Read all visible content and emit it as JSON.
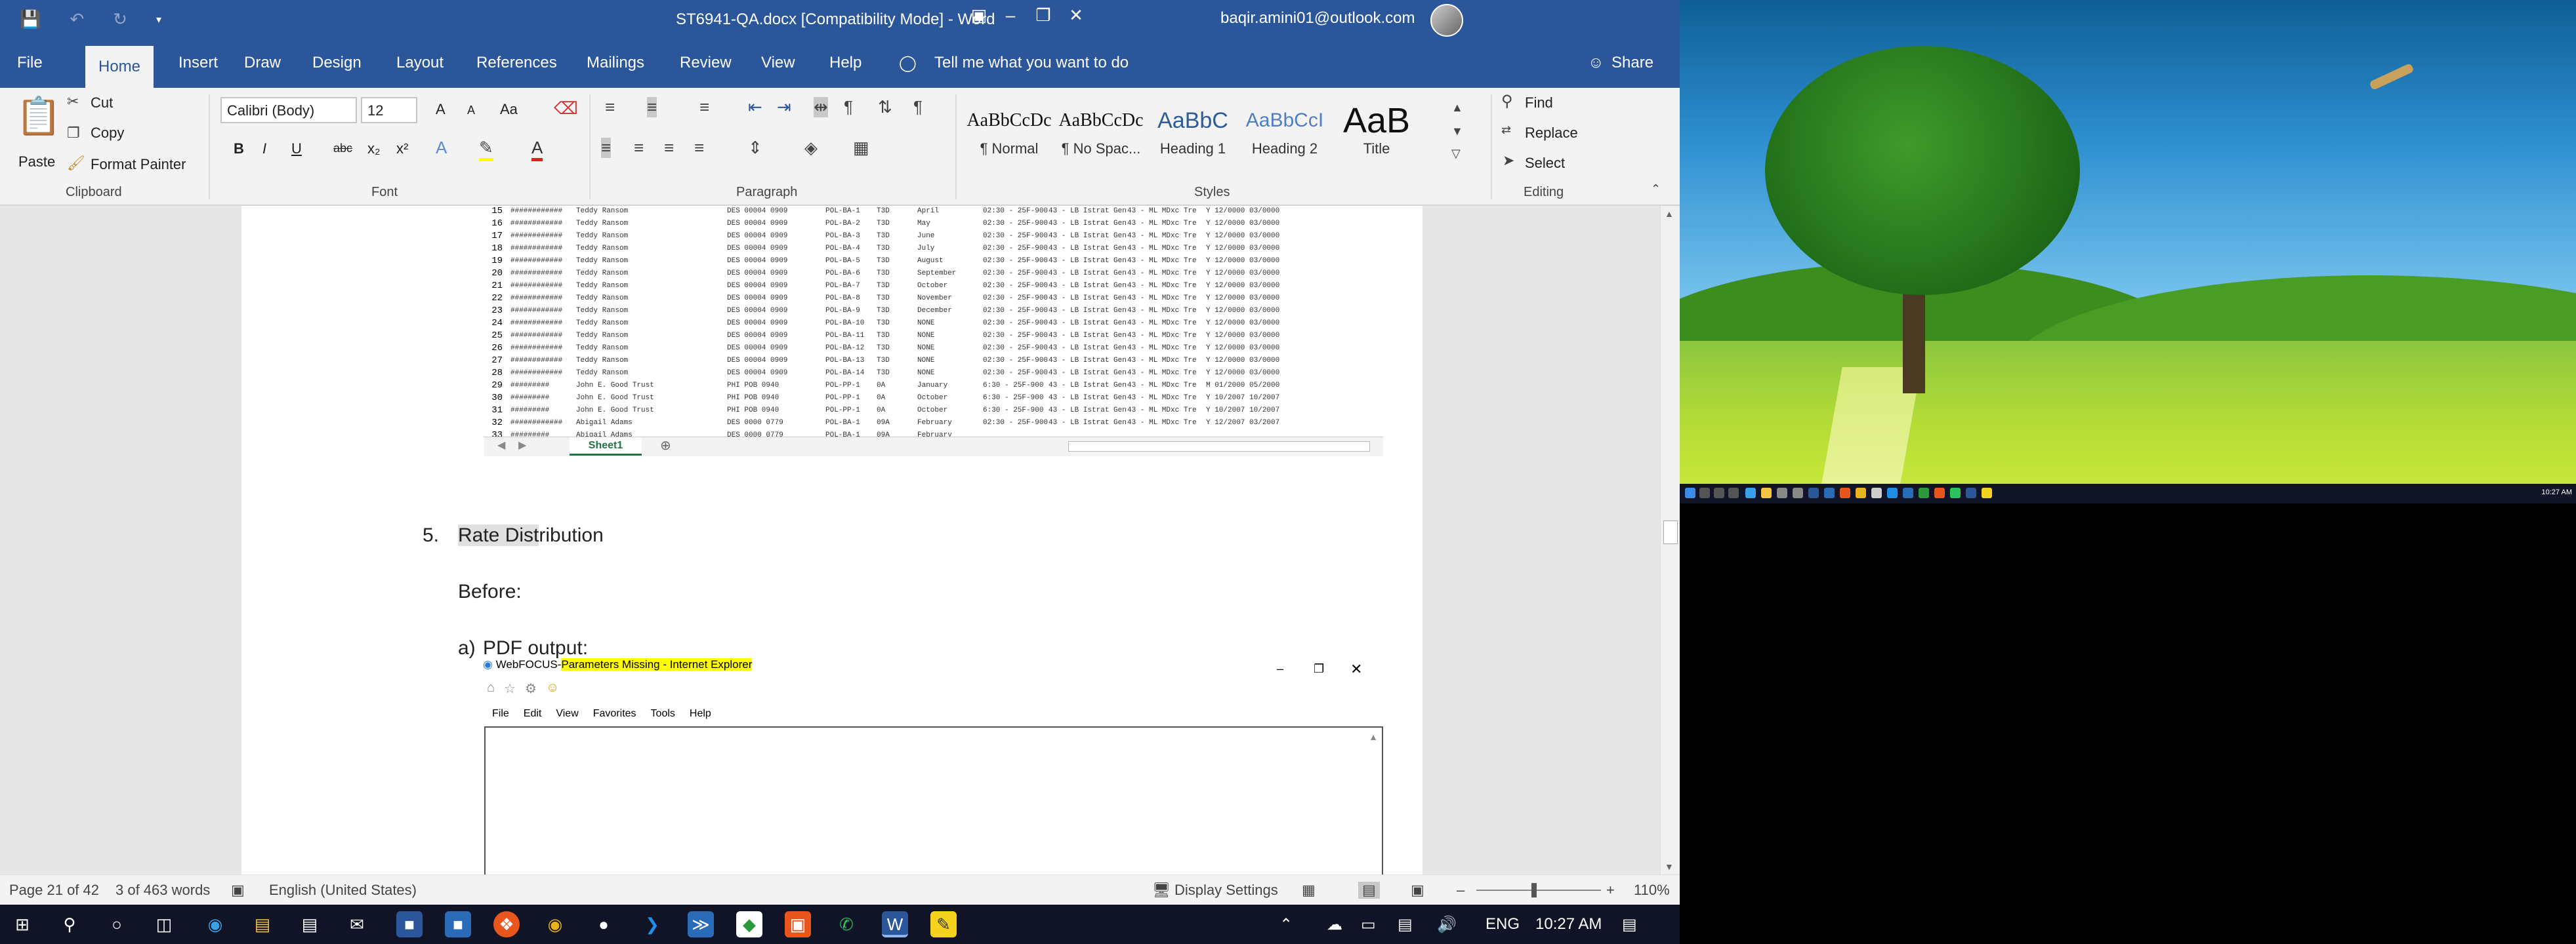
{
  "title_bar": {
    "document_title": "ST6941-QA.docx  [Compatibility Mode]  -  Word",
    "account": "baqir.amini01@outlook.com",
    "qat_icons": [
      "save-icon",
      "undo-icon",
      "redo-icon",
      "customize-qat-icon"
    ]
  },
  "tabs": {
    "file": "File",
    "home": "Home",
    "insert": "Insert",
    "draw": "Draw",
    "design": "Design",
    "layout": "Layout",
    "references": "References",
    "mailings": "Mailings",
    "review": "Review",
    "view": "View",
    "help": "Help",
    "tell_me": "Tell me what you want to do",
    "share": "Share"
  },
  "ribbon": {
    "clipboard": {
      "paste": "Paste",
      "cut": "Cut",
      "copy": "Copy",
      "format_painter": "Format Painter",
      "label": "Clipboard"
    },
    "font": {
      "name": "Calibri (Body)",
      "size": "12",
      "label": "Font",
      "bold": "B",
      "italic": "I",
      "underline": "U",
      "strike": "abc",
      "sub": "x₂",
      "sup": "x²",
      "grow": "A",
      "shrink": "A",
      "case": "Aa"
    },
    "paragraph": {
      "label": "Paragraph"
    },
    "styles": {
      "label": "Styles",
      "items": [
        {
          "preview": "AaBbCcDc",
          "name": "¶ Normal"
        },
        {
          "preview": "AaBbCcDc",
          "name": "¶ No Spac..."
        },
        {
          "preview": "AaBbC",
          "name": "Heading 1"
        },
        {
          "preview": "AaBbCcI",
          "name": "Heading 2"
        },
        {
          "preview": "AaB",
          "name": "Title"
        }
      ]
    },
    "editing": {
      "find": "Find",
      "replace": "Replace",
      "select": "Select",
      "label": "Editing"
    }
  },
  "spreadsheet": {
    "rows": [
      {
        "n": "15",
        "month": "April"
      },
      {
        "n": "16",
        "month": "May"
      },
      {
        "n": "17",
        "month": "June"
      },
      {
        "n": "18",
        "month": "July"
      },
      {
        "n": "19",
        "month": "August"
      },
      {
        "n": "20",
        "month": "September"
      },
      {
        "n": "21",
        "month": "October"
      },
      {
        "n": "22",
        "month": "November"
      },
      {
        "n": "23",
        "month": "December"
      },
      {
        "n": "24",
        "month": "NONE"
      },
      {
        "n": "25",
        "month": "NONE"
      },
      {
        "n": "26",
        "month": "NONE"
      },
      {
        "n": "27",
        "month": "NONE"
      },
      {
        "n": "28",
        "month": "NONE"
      },
      {
        "n": "29",
        "month": "January"
      },
      {
        "n": "30",
        "month": "October"
      },
      {
        "n": "31",
        "month": "October"
      },
      {
        "n": "32",
        "month": "February"
      },
      {
        "n": "33",
        "month": "February"
      }
    ],
    "sheet_tab": "Sheet1"
  },
  "document": {
    "item_number": "5.",
    "heading_selected": "Rate Dist",
    "heading_rest": "ribution",
    "before": "Before:",
    "sub_letter": "a)",
    "sub_item": "PDF output:",
    "ie_title_prefix": "WebFOCUS-",
    "ie_title_highlight": "Parameters Missing - Internet Explorer",
    "ie_menu": [
      "File",
      "Edit",
      "View",
      "Favorites",
      "Tools",
      "Help"
    ]
  },
  "status_bar": {
    "page": "Page 21 of 42",
    "words": "3 of 463 words",
    "language": "English (United States)",
    "display_settings": "Display Settings",
    "zoom": "110%"
  },
  "taskbar": {
    "language": "ENG",
    "time": "10:27 AM",
    "icons": [
      "start-icon",
      "search-icon",
      "task-view-icon",
      "widgets-icon",
      "edge-icon",
      "file-explorer-icon",
      "store-icon",
      "mail-icon",
      "app-icon",
      "app-icon",
      "app-icon",
      "chrome-icon",
      "app-icon",
      "vscode-icon",
      "app-icon",
      "app-icon",
      "app-icon",
      "whatsapp-icon",
      "word-icon",
      "sticky-notes-icon"
    ]
  },
  "desktop": {
    "time": "10:27 AM"
  }
}
